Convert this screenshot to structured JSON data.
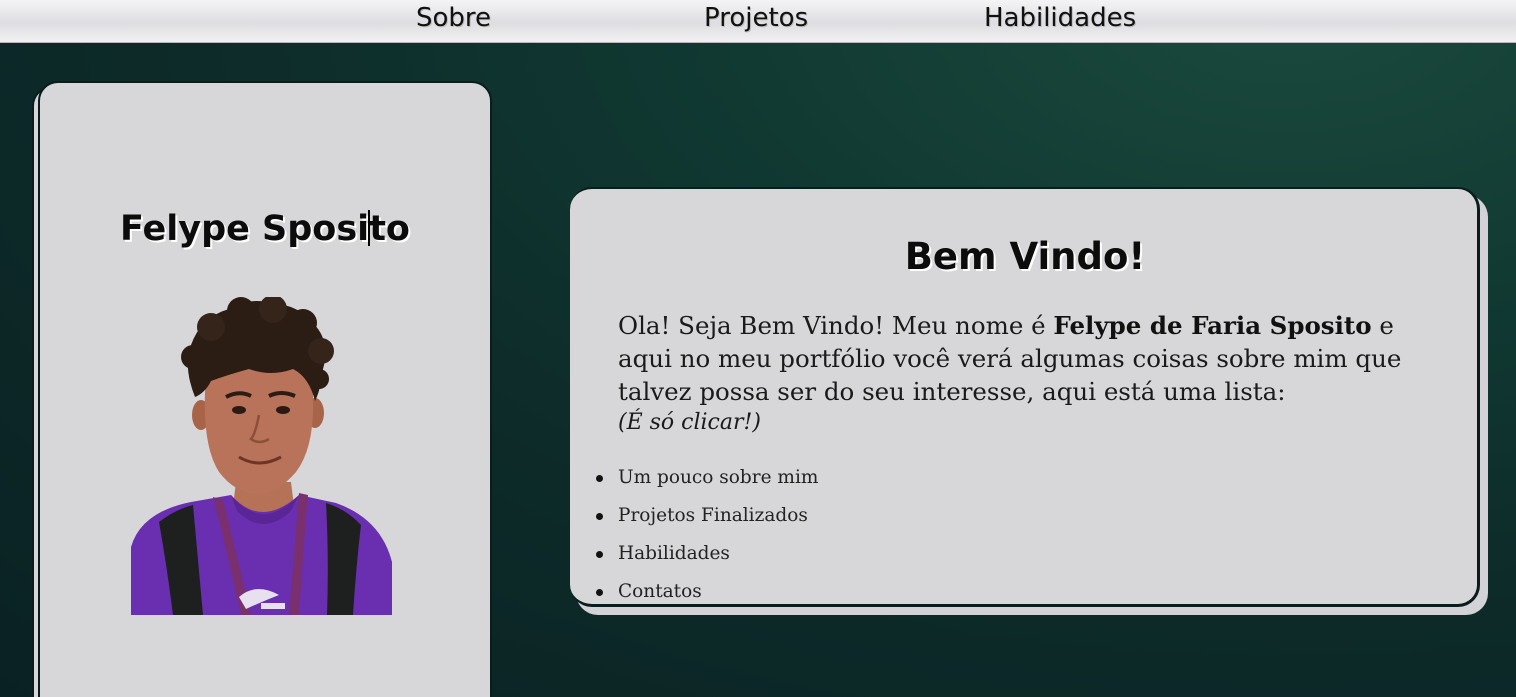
{
  "nav": {
    "items": [
      {
        "label": "Sobre"
      },
      {
        "label": "Projetos"
      },
      {
        "label": "Habilidades"
      }
    ]
  },
  "profile": {
    "name_part1": "Felype Sposi",
    "name_part2": "to",
    "photo_icon": "portrait-photo"
  },
  "welcome": {
    "title": "Bem Vindo!",
    "intro_before_name": "Ola! Seja Bem Vindo! Meu nome é ",
    "name": "Felype de Faria Sposito",
    "intro_after_name": " e aqui no meu portfólio você verá algumas coisas sobre mim que talvez possa ser do seu interesse, aqui está uma lista:",
    "hint": "(É só clicar!)",
    "links": [
      {
        "label": "Um pouco sobre mim"
      },
      {
        "label": "Projetos Finalizados"
      },
      {
        "label": "Habilidades"
      },
      {
        "label": "Contatos"
      }
    ]
  },
  "colors": {
    "background_dark": "#0d2b29",
    "card": "#d7d7da",
    "shirt": "#6a2fb0",
    "lanyard": "#7a2f6e"
  }
}
